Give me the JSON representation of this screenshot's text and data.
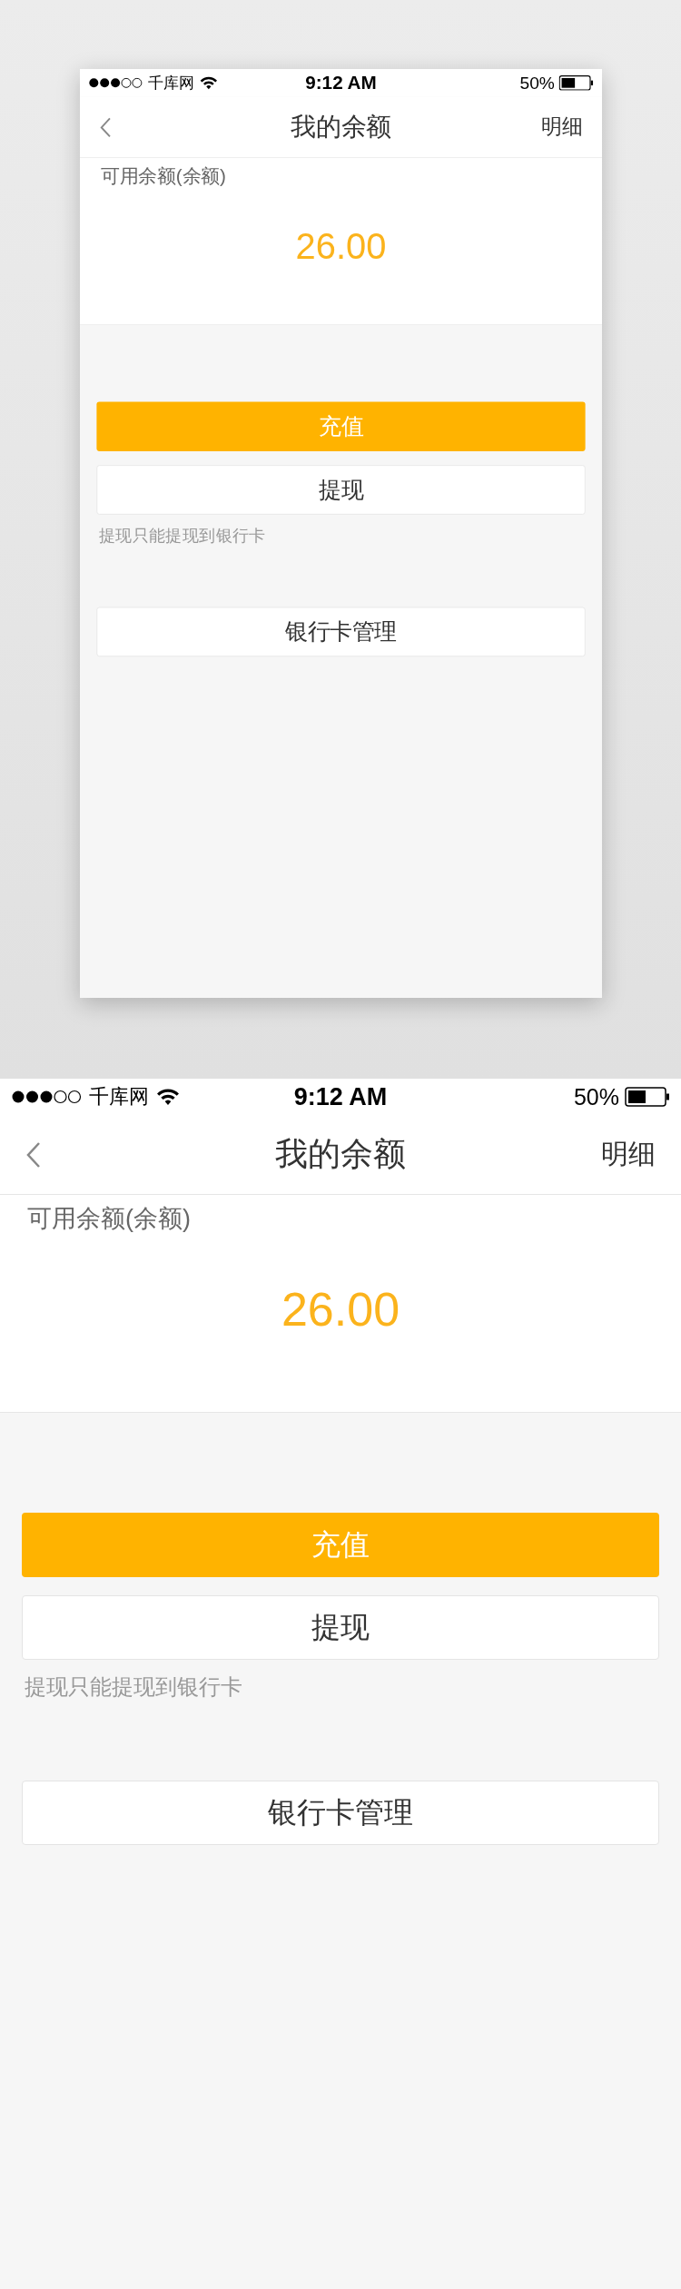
{
  "screens": [
    {
      "status_bar": {
        "carrier": "千库网",
        "time": "9:12 AM",
        "battery": "50%"
      },
      "nav": {
        "title": "我的余额",
        "action": "明细"
      },
      "balance": {
        "label": "可用余额(余额)",
        "amount": "26.00"
      },
      "buttons": [
        {
          "label": "充值",
          "kind": "primary"
        },
        {
          "label": "提现",
          "kind": "secondary"
        }
      ],
      "hint": "提现只能提现到银行卡",
      "bank_button": {
        "label": "银行卡管理",
        "kind": "secondary"
      }
    },
    {
      "status_bar": {
        "carrier": "千库网",
        "time": "9:12 AM",
        "battery": "50%"
      },
      "nav": {
        "title": "我的余额",
        "action": "明细"
      },
      "balance": {
        "label": "可用余额(余额)",
        "amount": "26.00"
      },
      "buttons": [
        {
          "label": "充值",
          "kind": "primary"
        },
        {
          "label": "提现",
          "kind": "secondary"
        }
      ],
      "hint": "提现只能提现到银行卡",
      "bank_button": {
        "label": "银行卡管理",
        "kind": "secondary"
      }
    }
  ]
}
